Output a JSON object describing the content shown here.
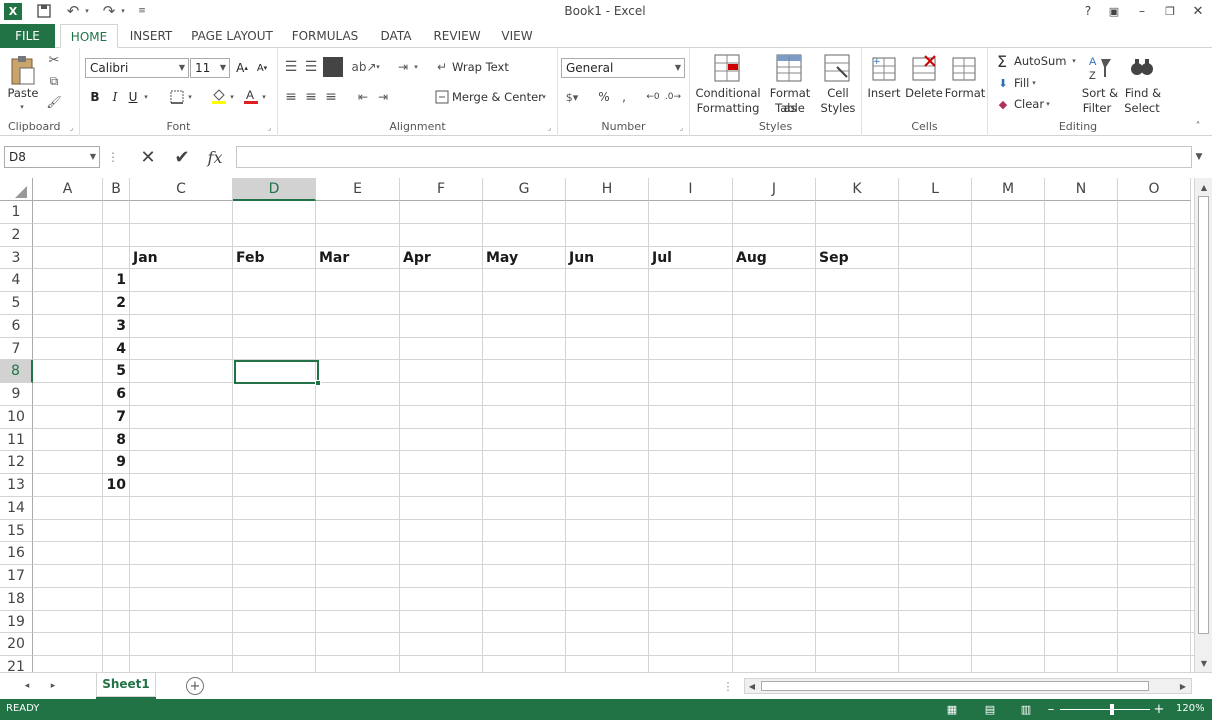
{
  "title": "Book1 - Excel",
  "tabs": [
    "FILE",
    "HOME",
    "INSERT",
    "PAGE LAYOUT",
    "FORMULAS",
    "DATA",
    "REVIEW",
    "VIEW"
  ],
  "ribbon": {
    "clipboard": {
      "paste": "Paste",
      "label": "Clipboard"
    },
    "font": {
      "name": "Calibri",
      "size": "11",
      "label": "Font",
      "bold": "B",
      "italic": "I",
      "underline": "U"
    },
    "alignment": {
      "wrap": "Wrap Text",
      "merge": "Merge & Center",
      "label": "Alignment"
    },
    "number": {
      "format": "General",
      "label": "Number"
    },
    "styles": {
      "conditional1": "Conditional",
      "conditional2": "Formatting",
      "format_table1": "Format as",
      "format_table2": "Table",
      "cell_styles1": "Cell",
      "cell_styles2": "Styles",
      "label": "Styles"
    },
    "cells": {
      "insert": "Insert",
      "delete": "Delete",
      "format": "Format",
      "label": "Cells"
    },
    "editing": {
      "autosum": "AutoSum",
      "fill": "Fill",
      "clear": "Clear",
      "sort1": "Sort &",
      "sort2": "Filter",
      "find1": "Find &",
      "find2": "Select",
      "label": "Editing"
    }
  },
  "formula_bar": {
    "name_box": "D8",
    "fx": "fx",
    "value": ""
  },
  "columns": [
    "A",
    "B",
    "C",
    "D",
    "E",
    "F",
    "G",
    "H",
    "I",
    "J",
    "K",
    "L",
    "M",
    "N",
    "O"
  ],
  "rows": [
    "1",
    "2",
    "3",
    "4",
    "5",
    "6",
    "7",
    "8",
    "9",
    "10",
    "11",
    "12",
    "13",
    "14",
    "15",
    "16",
    "17",
    "18",
    "19",
    "20",
    "21"
  ],
  "months": [
    "Jan",
    "Feb",
    "Mar",
    "Apr",
    "May",
    "Jun",
    "Jul",
    "Aug",
    "Sep"
  ],
  "numbers": [
    "1",
    "2",
    "3",
    "4",
    "5",
    "6",
    "7",
    "8",
    "9",
    "10"
  ],
  "sheet_tab": "Sheet1",
  "status": {
    "ready": "READY",
    "zoom": "120%"
  },
  "colors": {
    "accent": "#217346"
  }
}
